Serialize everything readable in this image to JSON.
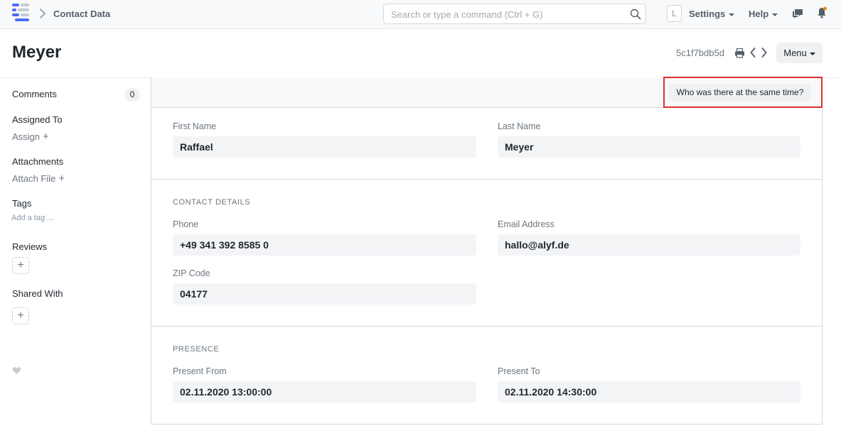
{
  "navbar": {
    "breadcrumb": "Contact Data",
    "search_placeholder": "Search or type a command (Ctrl + G)",
    "avatar_letter": "L",
    "settings_label": "Settings",
    "help_label": "Help"
  },
  "header": {
    "title": "Meyer",
    "doc_id": "5c1f7bdb5d",
    "menu_label": "Menu"
  },
  "sidebar": {
    "comments_label": "Comments",
    "comments_count": "0",
    "assigned_to_label": "Assigned To",
    "assign_label": "Assign",
    "attachments_label": "Attachments",
    "attach_file_label": "Attach File",
    "tags_label": "Tags",
    "add_tag_label": "Add a tag ...",
    "reviews_label": "Reviews",
    "shared_with_label": "Shared With"
  },
  "form": {
    "custom_button_label": "Who was there at the same time?",
    "name_section": {
      "first_name_label": "First Name",
      "first_name_value": "Raffael",
      "last_name_label": "Last Name",
      "last_name_value": "Meyer"
    },
    "contact_section": {
      "heading": "CONTACT DETAILS",
      "phone_label": "Phone",
      "phone_value": "+49 341 392 8585 0",
      "email_label": "Email Address",
      "email_value": "hallo@alyf.de",
      "zip_label": "ZIP Code",
      "zip_value": "04177"
    },
    "presence_section": {
      "heading": "PRESENCE",
      "present_from_label": "Present From",
      "present_from_value": "02.11.2020 13:00:00",
      "present_to_label": "Present To",
      "present_to_value": "02.11.2020 14:30:00"
    }
  },
  "colors": {
    "highlight_border": "#e03131",
    "logo_blue": "#4a6cf7",
    "logo_gray": "#c5cbd3"
  },
  "icons": [
    "app-logo-icon",
    "chevron-right-icon",
    "search-icon",
    "chat-icon",
    "bell-icon",
    "print-icon",
    "chevron-left-icon",
    "chevron-right-icon",
    "plus-icon",
    "heart-icon"
  ]
}
